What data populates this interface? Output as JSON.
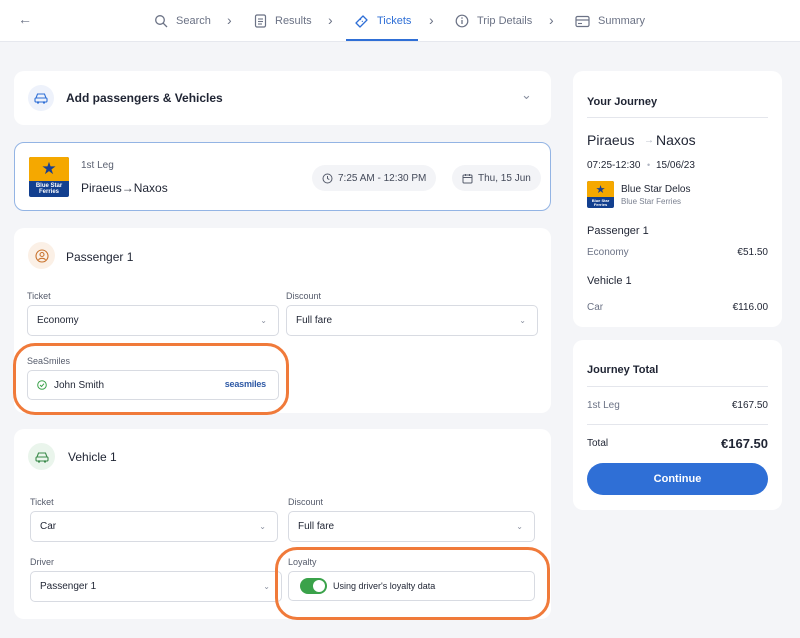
{
  "nav": {
    "back_symbol": "←",
    "steps": [
      {
        "label": "Search",
        "icon": "search-icon"
      },
      {
        "label": "Results",
        "icon": "document-icon"
      },
      {
        "label": "Tickets",
        "icon": "ticket-icon"
      },
      {
        "label": "Trip Details",
        "icon": "info-icon"
      },
      {
        "label": "Summary",
        "icon": "card-icon"
      }
    ],
    "active_step": "Tickets",
    "chevron": "›"
  },
  "add_passengers": {
    "label": "Add passengers & Vehicles",
    "chevron": "⌄"
  },
  "leg": {
    "leg_label": "1st Leg",
    "route": "Piraeus→Naxos",
    "time": "7:25 AM - 12:30 PM",
    "date": "Thu, 15 Jun",
    "logo_text_line1": "Blue Star",
    "logo_text_line2": "Ferries"
  },
  "passenger": {
    "title": "Passenger 1",
    "ticket_label": "Ticket",
    "ticket_value": "Economy",
    "discount_label": "Discount",
    "discount_value": "Full fare",
    "loyalty_label": "SeaSmiles",
    "loyalty_name": "John Smith",
    "loyalty_brand": "seasmiles"
  },
  "vehicle": {
    "title": "Vehicle 1",
    "ticket_label": "Ticket",
    "ticket_value": "Car",
    "discount_label": "Discount",
    "discount_value": "Full fare",
    "driver_label": "Driver",
    "driver_value": "Passenger 1",
    "loyalty_label": "Loyalty",
    "loyalty_text": "Using driver's loyalty data",
    "loyalty_enabled": true
  },
  "journey": {
    "heading": "Your Journey",
    "from": "Piraeus",
    "arrow": "→",
    "to": "Naxos",
    "times": "07:25-12:30",
    "dot": "•",
    "date": "15/06/23",
    "vessel": "Blue Star Delos",
    "operator": "Blue Star Ferries",
    "passenger_heading": "Passenger 1",
    "passenger_class": "Economy",
    "passenger_price": "€51.50",
    "vehicle_heading": "Vehicle 1",
    "vehicle_type": "Car",
    "vehicle_price": "€116.00"
  },
  "total": {
    "heading": "Journey Total",
    "leg_label": "1st Leg",
    "leg_price": "€167.50",
    "total_label": "Total",
    "total_price": "€167.50",
    "continue_label": "Continue"
  },
  "colors": {
    "accent": "#2f6fd6",
    "highlight": "#f07a3a",
    "toggle_on": "#3aa24a",
    "brand_yellow": "#f5a800",
    "brand_blue": "#123f8f"
  }
}
